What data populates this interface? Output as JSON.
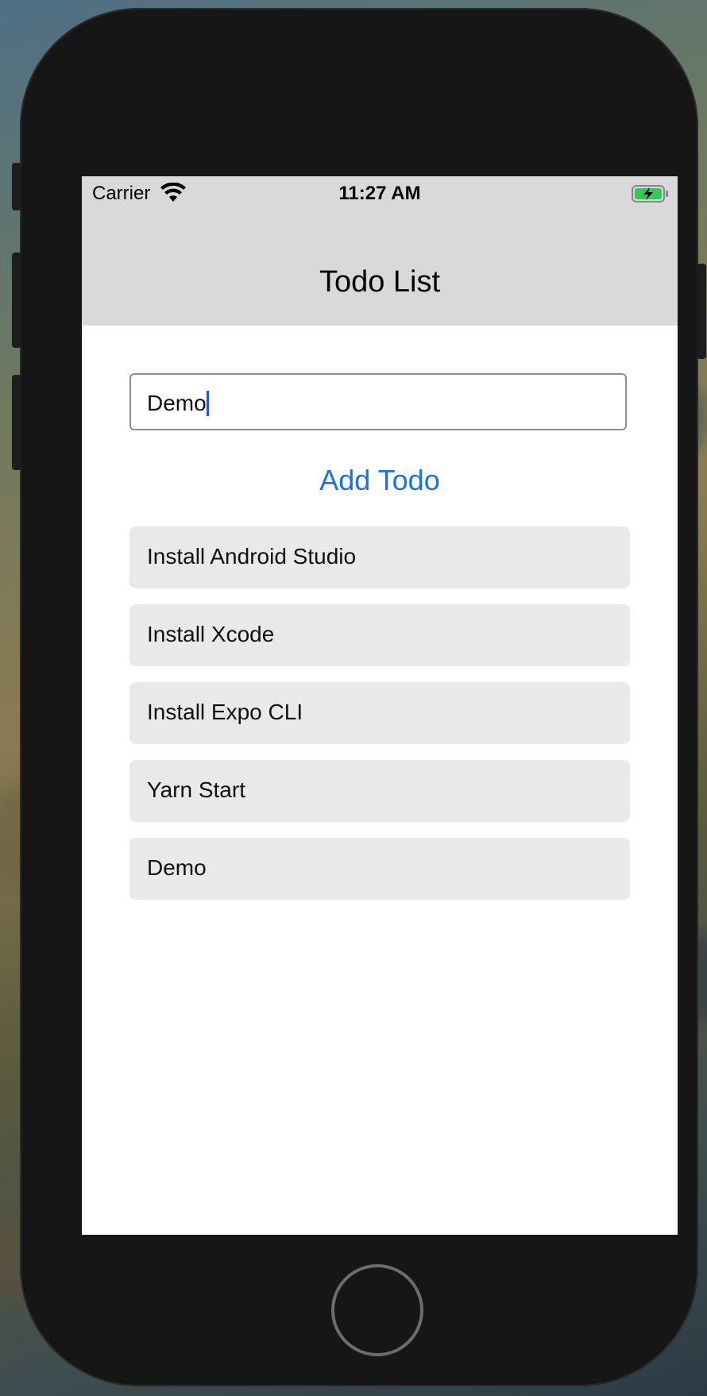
{
  "status_bar": {
    "carrier": "Carrier",
    "time": "11:27 AM",
    "wifi_icon": "wifi-icon",
    "battery_icon": "battery-charging-icon"
  },
  "header": {
    "title": "Todo List",
    "background": "#d9d9d9"
  },
  "input": {
    "value": "Demo"
  },
  "add_button": {
    "label": "Add Todo",
    "color": "#1f6fe8"
  },
  "todos": [
    {
      "label": "Install Android Studio"
    },
    {
      "label": "Install Xcode"
    },
    {
      "label": "Install Expo CLI"
    },
    {
      "label": "Yarn Start"
    },
    {
      "label": "Demo"
    }
  ],
  "device": {
    "home_button_icon": "home-button-icon"
  }
}
